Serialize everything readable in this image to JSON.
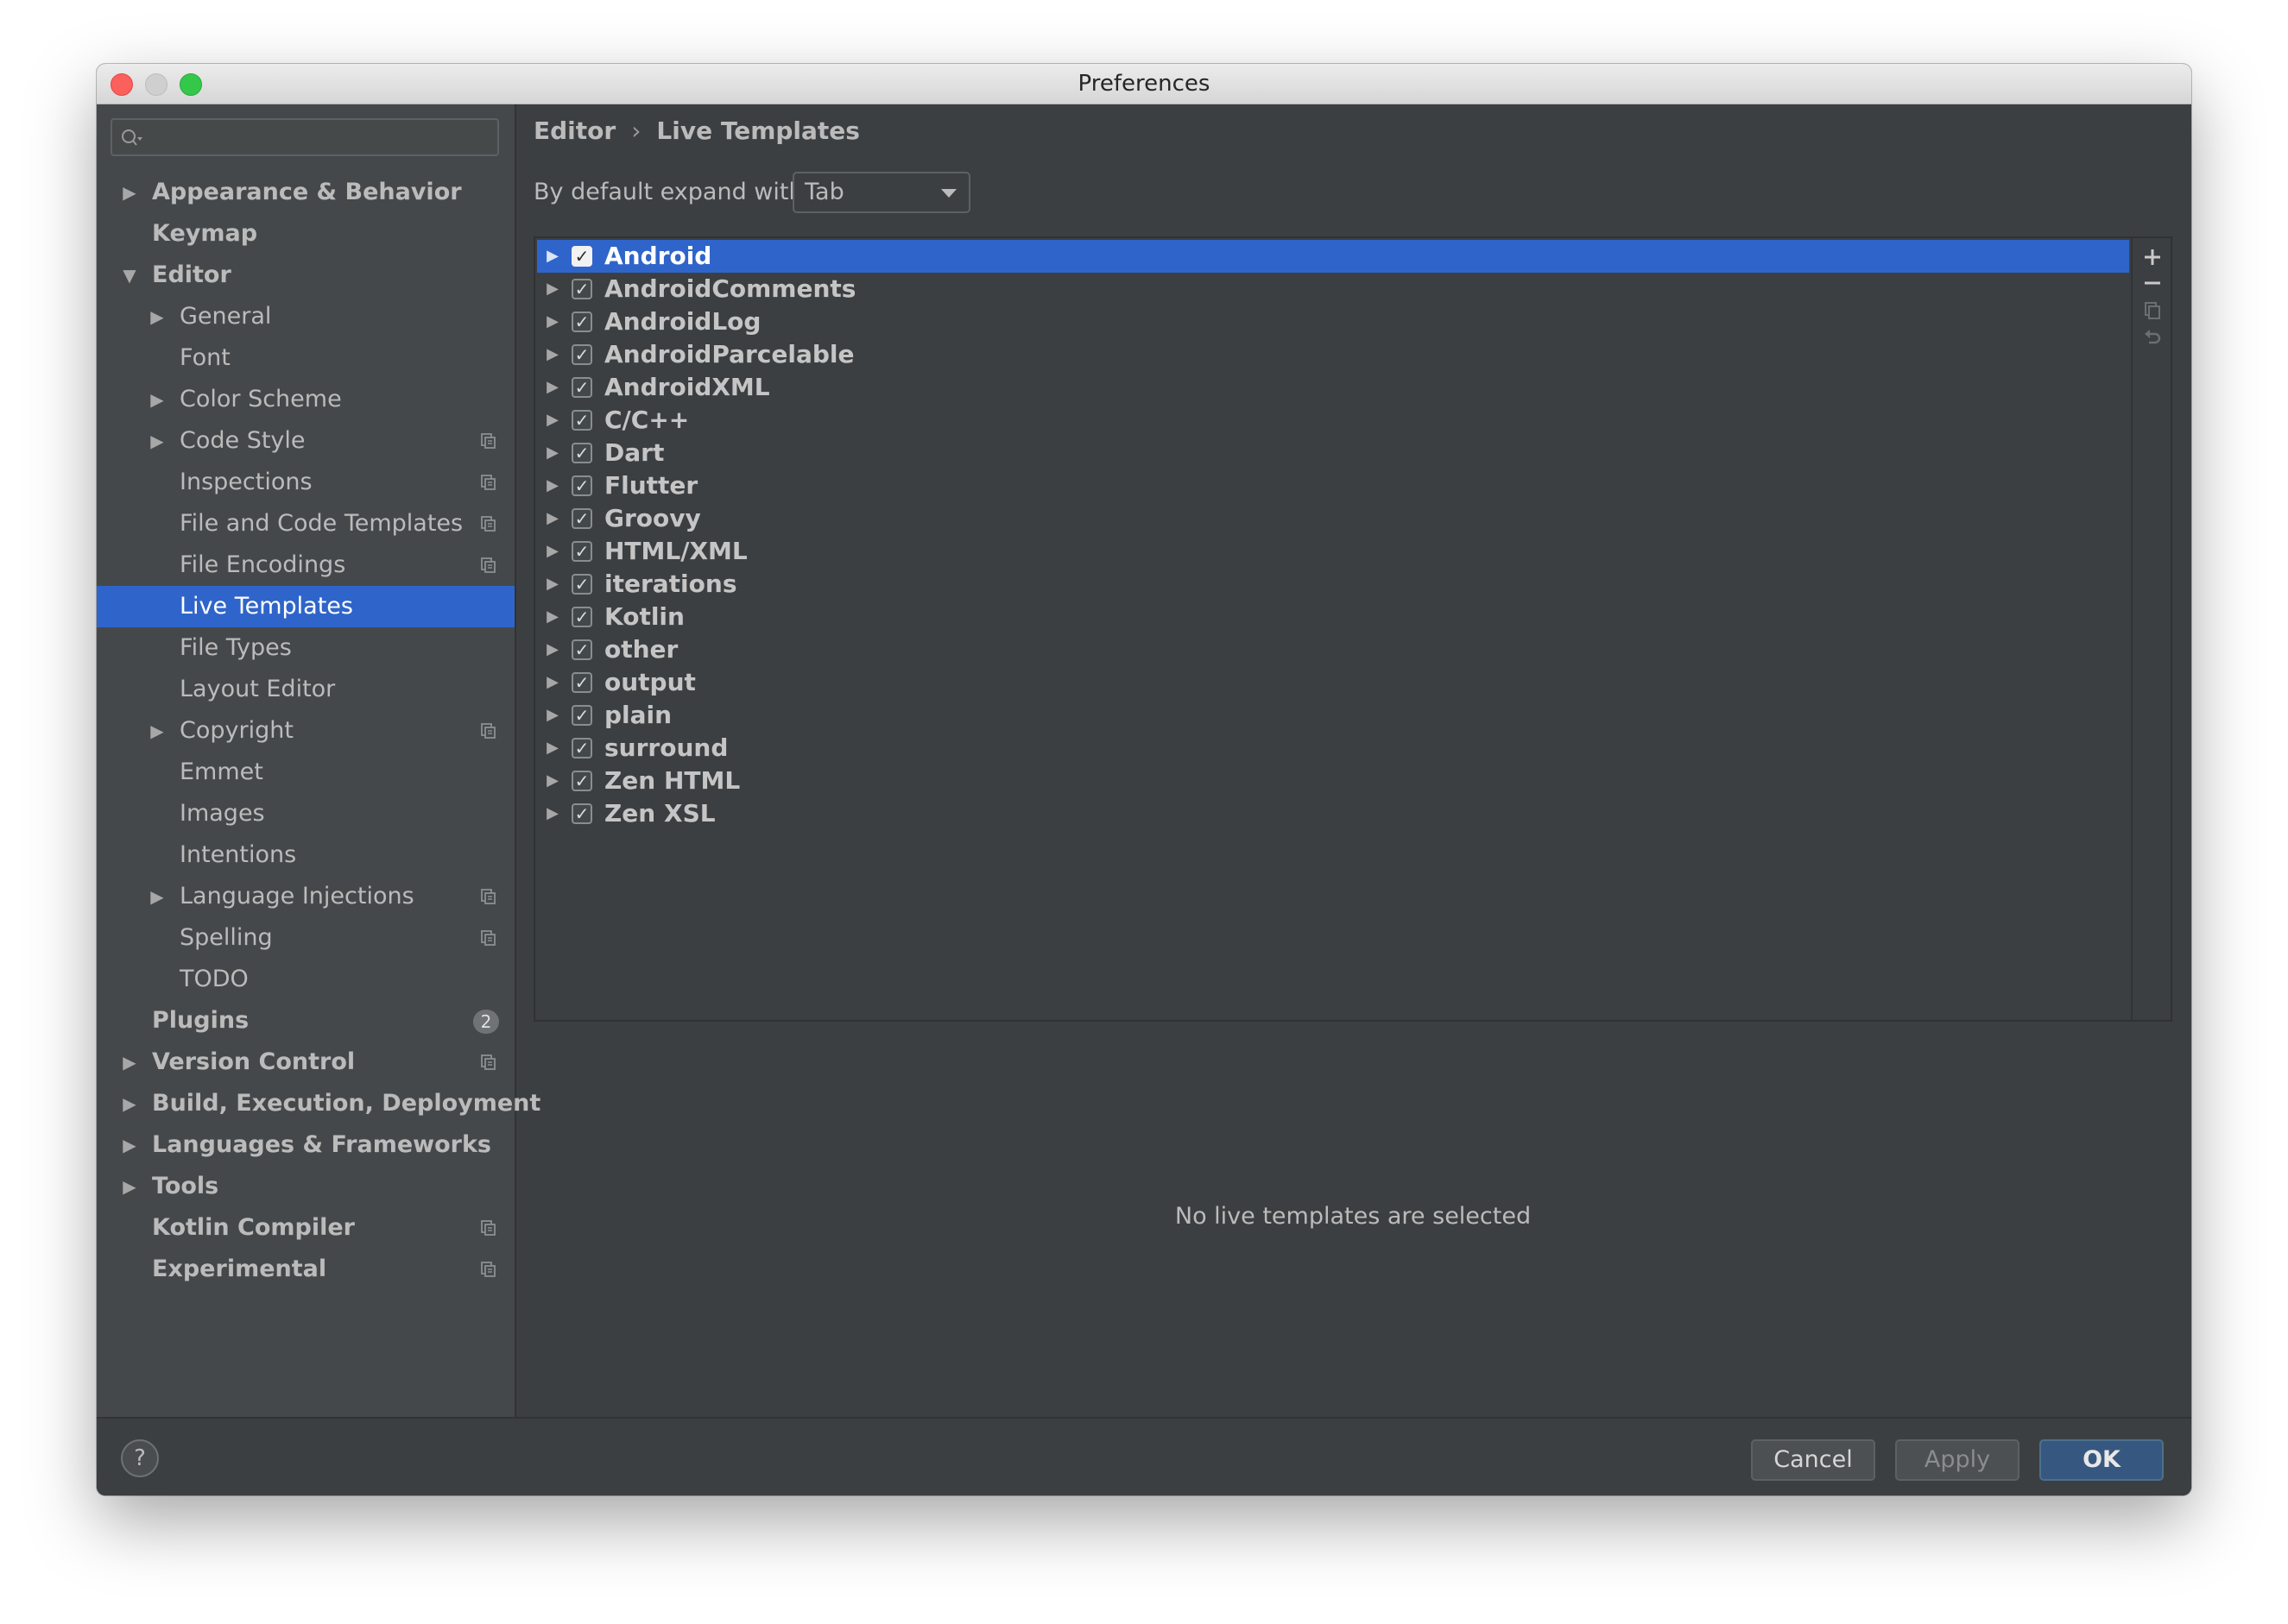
{
  "window": {
    "title": "Preferences"
  },
  "sidebar": {
    "search": {
      "value": "",
      "placeholder": ""
    },
    "items": [
      {
        "label": "Appearance & Behavior",
        "level": 0,
        "arrow": "right",
        "bold": true
      },
      {
        "label": "Keymap",
        "level": 0,
        "bold": true
      },
      {
        "label": "Editor",
        "level": 0,
        "arrow": "down",
        "bold": true
      },
      {
        "label": "General",
        "level": 1,
        "arrow": "right"
      },
      {
        "label": "Font",
        "level": 1
      },
      {
        "label": "Color Scheme",
        "level": 1,
        "arrow": "right"
      },
      {
        "label": "Code Style",
        "level": 1,
        "arrow": "right",
        "project_icon": true
      },
      {
        "label": "Inspections",
        "level": 1,
        "project_icon": true
      },
      {
        "label": "File and Code Templates",
        "level": 1,
        "project_icon": true
      },
      {
        "label": "File Encodings",
        "level": 1,
        "project_icon": true
      },
      {
        "label": "Live Templates",
        "level": 1,
        "selected": true
      },
      {
        "label": "File Types",
        "level": 1
      },
      {
        "label": "Layout Editor",
        "level": 1
      },
      {
        "label": "Copyright",
        "level": 1,
        "arrow": "right",
        "project_icon": true
      },
      {
        "label": "Emmet",
        "level": 1
      },
      {
        "label": "Images",
        "level": 1
      },
      {
        "label": "Intentions",
        "level": 1
      },
      {
        "label": "Language Injections",
        "level": 1,
        "arrow": "right",
        "project_icon": true
      },
      {
        "label": "Spelling",
        "level": 1,
        "project_icon": true
      },
      {
        "label": "TODO",
        "level": 1
      },
      {
        "label": "Plugins",
        "level": 0,
        "bold": true,
        "badge": "2"
      },
      {
        "label": "Version Control",
        "level": 0,
        "arrow": "right",
        "bold": true,
        "project_icon": true
      },
      {
        "label": "Build, Execution, Deployment",
        "level": 0,
        "arrow": "right",
        "bold": true
      },
      {
        "label": "Languages & Frameworks",
        "level": 0,
        "arrow": "right",
        "bold": true
      },
      {
        "label": "Tools",
        "level": 0,
        "arrow": "right",
        "bold": true
      },
      {
        "label": "Kotlin Compiler",
        "level": 0,
        "bold": true,
        "project_icon": true
      },
      {
        "label": "Experimental",
        "level": 0,
        "bold": true,
        "project_icon": true
      }
    ]
  },
  "breadcrumb": {
    "parent": "Editor",
    "separator": "›",
    "current": "Live Templates"
  },
  "expand": {
    "label": "By default expand with",
    "value": "Tab"
  },
  "templates": [
    {
      "label": "Android",
      "checked": true,
      "selected": true
    },
    {
      "label": "AndroidComments",
      "checked": true
    },
    {
      "label": "AndroidLog",
      "checked": true
    },
    {
      "label": "AndroidParcelable",
      "checked": true
    },
    {
      "label": "AndroidXML",
      "checked": true
    },
    {
      "label": "C/C++",
      "checked": true
    },
    {
      "label": "Dart",
      "checked": true
    },
    {
      "label": "Flutter",
      "checked": true
    },
    {
      "label": "Groovy",
      "checked": true
    },
    {
      "label": "HTML/XML",
      "checked": true
    },
    {
      "label": "iterations",
      "checked": true
    },
    {
      "label": "Kotlin",
      "checked": true
    },
    {
      "label": "other",
      "checked": true
    },
    {
      "label": "output",
      "checked": true
    },
    {
      "label": "plain",
      "checked": true
    },
    {
      "label": "surround",
      "checked": true
    },
    {
      "label": "Zen HTML",
      "checked": true
    },
    {
      "label": "Zen XSL",
      "checked": true
    }
  ],
  "toolbar": {
    "icons": [
      "plus-icon",
      "minus-icon",
      "copy-icon",
      "undo-icon"
    ]
  },
  "empty_message": "No live templates are selected",
  "footer": {
    "help": "?",
    "cancel": "Cancel",
    "apply": "Apply",
    "ok": "OK"
  },
  "colors": {
    "selection": "#2f65ca",
    "background": "#3c3f41",
    "sidebar": "#45484a",
    "ok_button": "#365880"
  }
}
